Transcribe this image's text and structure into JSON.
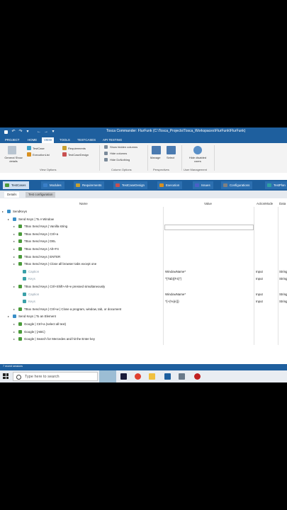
{
  "window": {
    "title": "Tosca Commander: FlurFunk (C:\\Tosca_Projects\\Tosca_Workspaces\\FlurFunk\\FlurFunk)"
  },
  "ribbon_tabs": [
    {
      "label": "PROJECT",
      "active": false
    },
    {
      "label": "HOME",
      "active": false
    },
    {
      "label": "VIEW",
      "active": true
    },
    {
      "label": "TOOLS",
      "active": false
    },
    {
      "label": "TESTCASES",
      "active": false
    },
    {
      "label": "API TESTING",
      "active": false
    }
  ],
  "ribbon": {
    "general_show_details": "General Show details",
    "testcase": "TestCase",
    "executionlist": "ExecutionList",
    "requirements": "Requirements",
    "testcasedesign": "TestCaseDesign",
    "show_hidden_columns": "Show hidden columns",
    "hide_columns": "Hide columns",
    "hide_donothing": "Hide DoNothing",
    "manage": "Manage",
    "select": "Select",
    "hide_disabled_users": "Hide disabled users",
    "groups": {
      "view_options": "View Options",
      "column_options": "Column Options",
      "perspectives": "Perspectives",
      "user_management": "User Management"
    }
  },
  "doc_tabs": [
    {
      "label": "TestCases",
      "active": true,
      "color": "#4a9a3a"
    },
    {
      "label": "Modules",
      "active": false,
      "color": "#3a7fc8"
    },
    {
      "label": "Requirements",
      "active": false,
      "color": "#c8a030"
    },
    {
      "label": "TestCaseDesign",
      "active": false,
      "color": "#c85050"
    },
    {
      "label": "Execution",
      "active": false,
      "color": "#d89020"
    },
    {
      "label": "Issues",
      "active": false,
      "color": "#4a60c8"
    },
    {
      "label": "Configurations",
      "active": false,
      "color": "#808080"
    },
    {
      "label": "TestPlan",
      "active": false,
      "color": "#30a0a0"
    }
  ],
  "sub_tabs": [
    {
      "label": "Details",
      "active": true
    },
    {
      "label": "Test configuration",
      "active": false
    }
  ],
  "columns": {
    "name": "Name",
    "value": "Value",
    "action_mode": "ActionMode",
    "data_type": "Data"
  },
  "tree": [
    {
      "text": "SendKeys",
      "level": 0,
      "type": "folder",
      "value": "",
      "action": "",
      "dtype": ""
    },
    {
      "text": "Send Keys | To A Window",
      "level": 1,
      "type": "folder",
      "value": "",
      "action": "",
      "dtype": ""
    },
    {
      "text": "TBox Send Keys | Vanilla string",
      "level": 2,
      "type": "testcase",
      "value": "",
      "action": "",
      "dtype": ""
    },
    {
      "text": "TBox Send Keys | Ctrl+a",
      "level": 2,
      "type": "testcase",
      "value": "",
      "action": "",
      "dtype": ""
    },
    {
      "text": "TBox Send Keys | DEL",
      "level": 2,
      "type": "testcase",
      "value": "",
      "action": "",
      "dtype": ""
    },
    {
      "text": "TBox Send Keys | Alt+F4",
      "level": 2,
      "type": "testcase",
      "value": "",
      "action": "",
      "dtype": ""
    },
    {
      "text": "TBox Send Keys | ENTER",
      "level": 2,
      "type": "testcase",
      "value": "",
      "action": "",
      "dtype": ""
    },
    {
      "text": "TBox Send Keys | Close all browser tabs except one",
      "level": 2,
      "type": "testcase",
      "value": "",
      "action": "",
      "dtype": ""
    },
    {
      "text": "Caption",
      "level": 3,
      "type": "param",
      "value": "WindowName*",
      "action": "Input",
      "dtype": "String"
    },
    {
      "text": "Keys",
      "level": 3,
      "type": "param",
      "value": "^{Tab}{F4}\"}",
      "action": "Input",
      "dtype": "String"
    },
    {
      "text": "TBox Send Keys | Ctrl+Shift+Alt+e pressed simultaneously",
      "level": 2,
      "type": "testcase",
      "value": "",
      "action": "",
      "dtype": ""
    },
    {
      "text": "Caption",
      "level": 3,
      "type": "param",
      "value": "WindowName*",
      "action": "Input",
      "dtype": "String"
    },
    {
      "text": "Keys",
      "level": 3,
      "type": "param",
      "value": "^{+{%{e}}}",
      "action": "Input",
      "dtype": "String"
    },
    {
      "text": "TBox Send Keys | Ctrl+w | Close a program, window, tab, or document",
      "level": 2,
      "type": "testcase",
      "value": "",
      "action": "",
      "dtype": ""
    },
    {
      "text": "Send Keys | To an Element",
      "level": 1,
      "type": "folder",
      "value": "",
      "action": "",
      "dtype": ""
    },
    {
      "text": "Google | Ctrl+a (select all text)",
      "level": 2,
      "type": "testcase",
      "value": "",
      "action": "",
      "dtype": ""
    },
    {
      "text": "Google | {ABC}",
      "level": 2,
      "type": "testcase",
      "value": "",
      "action": "",
      "dtype": ""
    },
    {
      "text": "Google | Search for Mercedes and hit the Enter key",
      "level": 2,
      "type": "testcase",
      "value": "",
      "action": "",
      "dtype": ""
    }
  ],
  "status": {
    "text": "7 recent sessions"
  },
  "taskbar": {
    "search_placeholder": "Type here to search"
  }
}
